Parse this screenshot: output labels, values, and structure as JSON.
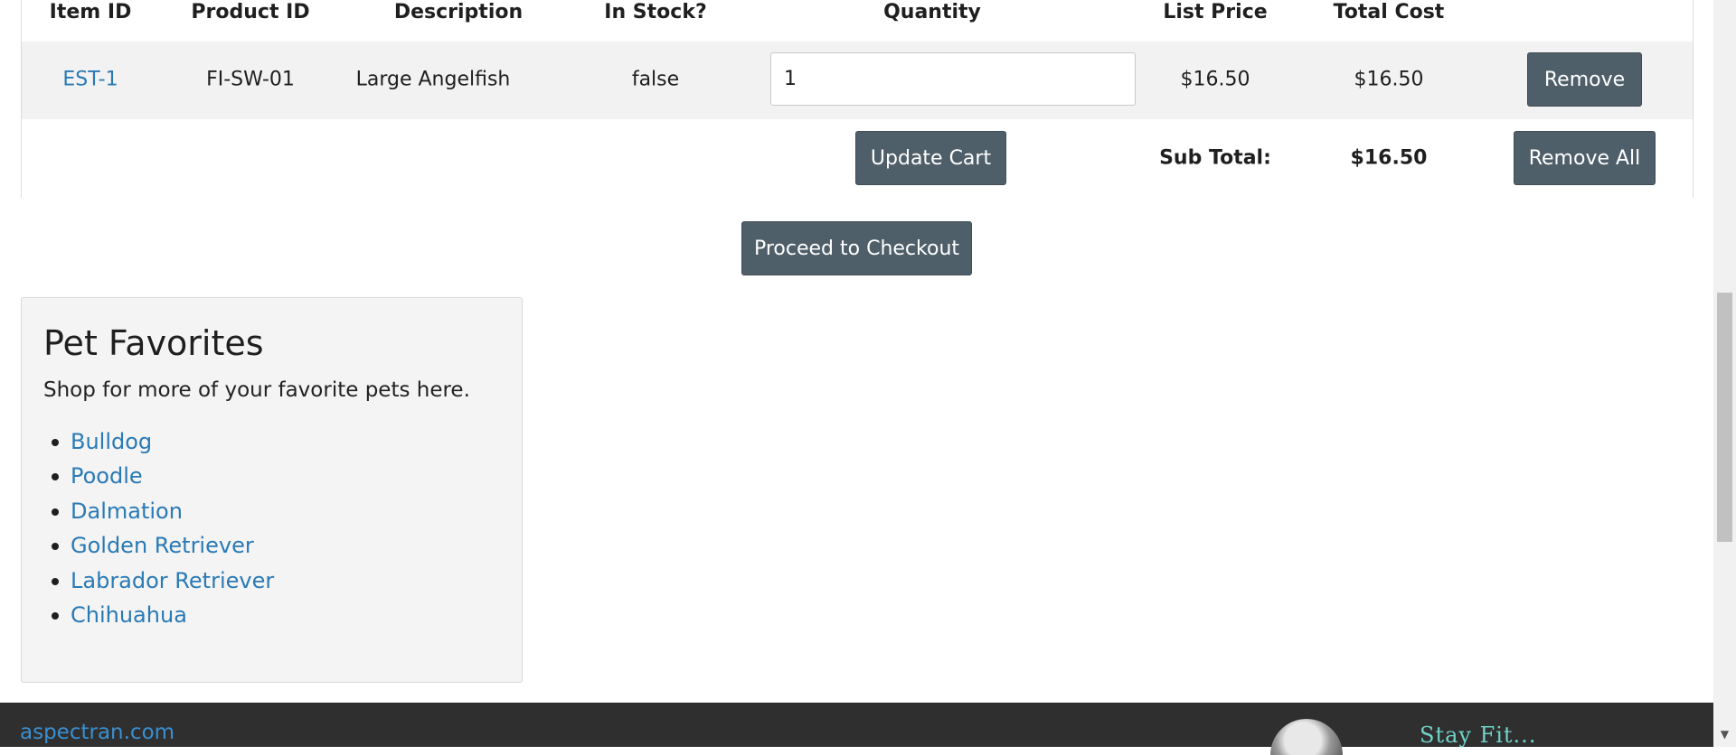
{
  "cart": {
    "headers": [
      "Item ID",
      "Product ID",
      "Description",
      "In Stock?",
      "Quantity",
      "List Price",
      "Total Cost"
    ],
    "items": [
      {
        "item_id": "EST-1",
        "product_id": "FI-SW-01",
        "description": "Large Angelfish",
        "in_stock": "false",
        "quantity": "1",
        "list_price": "$16.50",
        "total_cost": "$16.50",
        "remove_label": "Remove"
      }
    ],
    "update_label": "Update Cart",
    "subtotal_label": "Sub Total:",
    "subtotal_value": "$16.50",
    "remove_all_label": "Remove All"
  },
  "checkout_label": "Proceed to Checkout",
  "favorites": {
    "title": "Pet Favorites",
    "text": "Shop for more of your favorite pets here.",
    "items": [
      "Bulldog",
      "Poodle",
      "Dalmation",
      "Golden Retriever",
      "Labrador Retriever",
      "Chihuahua"
    ]
  },
  "footer": {
    "site": "aspectran.com",
    "banner_text": "Stay Fit..."
  },
  "colors": {
    "button_bg": "#4f5f69",
    "link": "#2a7ab5",
    "footer_bg": "#2f2f2f"
  },
  "icons": {
    "scroll_down": "chevron-down-icon"
  }
}
